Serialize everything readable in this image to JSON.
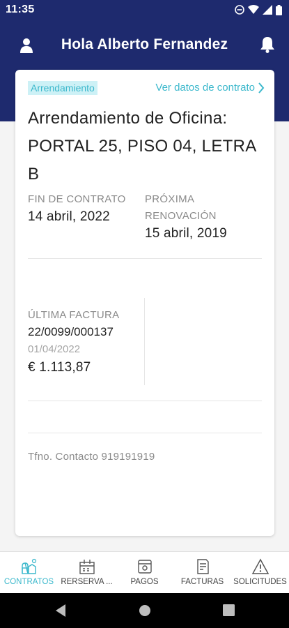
{
  "status": {
    "time": "11:35"
  },
  "header": {
    "title": "Hola Alberto Fernandez",
    "user_icon": "user-icon",
    "bell_icon": "bell-icon"
  },
  "card": {
    "badge": "Arrendamiento",
    "contract_link": "Ver datos de contrato",
    "title": "Arrendamiento de Oficina: PORTAL 25, PISO 04, LETRA B",
    "end_contract_label": "FIN DE CONTRATO",
    "end_contract_value": "14 abril, 2022",
    "renewal_label_1": "PRÓXIMA",
    "renewal_label_2": "RENOVACIÓN",
    "renewal_value": "15 abril, 2019",
    "last_invoice_label": "ÚLTIMA FACTURA",
    "last_invoice_number": "22/0099/000137",
    "last_invoice_date": "01/04/2022",
    "last_invoice_amount": "€ 1.113,87",
    "contact": "Tfno. Contacto 919191919"
  },
  "nav": {
    "items": [
      {
        "label": "CONTRATOS",
        "icon": "contracts-icon",
        "active": true
      },
      {
        "label": "RERSERVA ...",
        "icon": "reservation-icon",
        "active": false
      },
      {
        "label": "PAGOS",
        "icon": "payments-icon",
        "active": false
      },
      {
        "label": "FACTURAS",
        "icon": "invoices-icon",
        "active": false
      },
      {
        "label": "SOLICITUDES",
        "icon": "requests-icon",
        "active": false
      }
    ]
  },
  "colors": {
    "header": "#1e2a6e",
    "accent": "#3bb8cc",
    "badge_bg": "#cdf1f6"
  }
}
